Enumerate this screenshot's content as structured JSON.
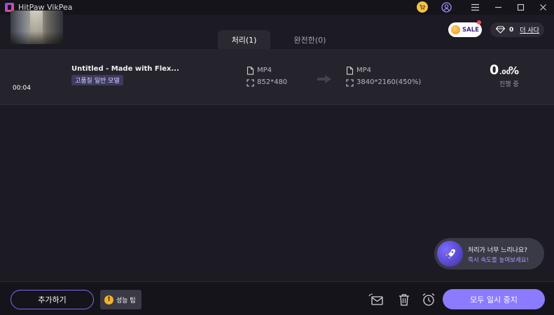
{
  "window": {
    "title": "HitPaw VikPea"
  },
  "header": {
    "tabs": [
      {
        "label": "처리(1)",
        "active": true
      },
      {
        "label": "완전한(0)",
        "active": false
      }
    ],
    "sale_label": "SALE",
    "credits_count": "0",
    "buy_more_label": "더 사다"
  },
  "task": {
    "file_name": "Untitled - Made with Flex...",
    "duration": "00:04",
    "model_tag": "고품질 일반 모델",
    "source": {
      "format": "MP4",
      "resolution": "852*480"
    },
    "output": {
      "format": "MP4",
      "resolution": "3840*2160(450%)"
    },
    "progress_int": "0",
    "progress_dec": ".00",
    "progress_sign": "%",
    "progress_percent": 0,
    "status": "진행 중"
  },
  "speed_tip": {
    "title": "처리가 너무 느리나요?",
    "link": "즉시 속도를 높여보세요!"
  },
  "bottom": {
    "add_label": "추가하기",
    "perf_tip_label": "성능 팁",
    "pause_all_label": "모두 일시 중지"
  },
  "colors": {
    "accent": "#8a7bff",
    "background": "#1c1b23",
    "row": "#25242c",
    "warning": "#f2b227"
  }
}
